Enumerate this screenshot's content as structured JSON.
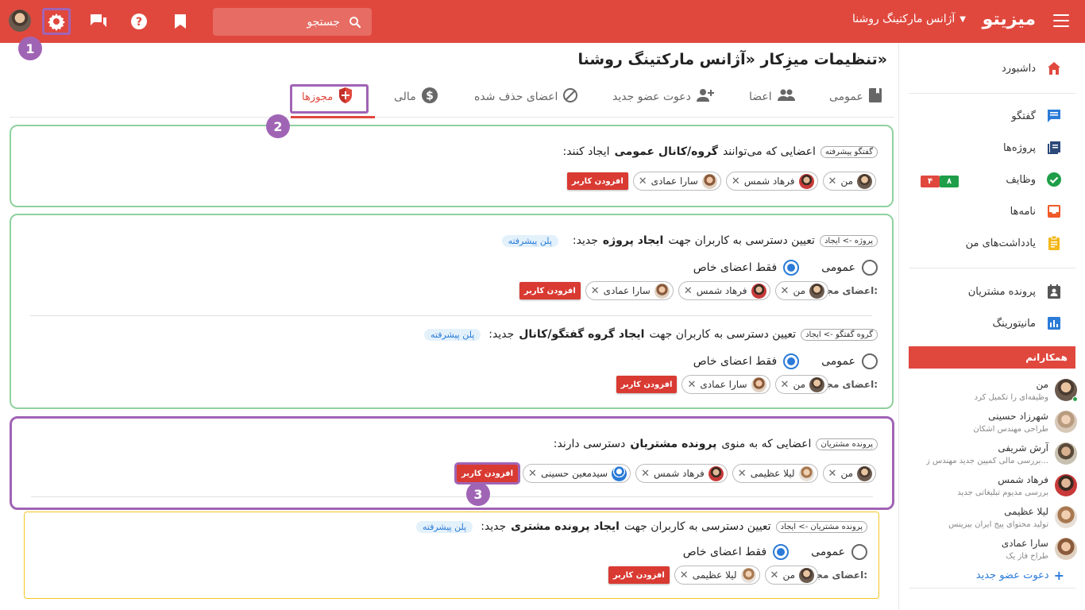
{
  "topbar": {
    "brand": "میزیتو",
    "agency": "آژانس مارکتینگ روشنا",
    "search_placeholder": "جستجو",
    "markers": [
      "1",
      "2",
      "3"
    ]
  },
  "sidebar": {
    "items": [
      {
        "label": "داشبورد",
        "icon": "home-icon",
        "color": "#e0483e"
      },
      {
        "label": "گفتگو",
        "icon": "chat-icon",
        "color": "#2b7bd8"
      },
      {
        "label": "پروژه‌ها",
        "icon": "projects-icon",
        "color": "#2c4a7a"
      },
      {
        "label": "وظایف",
        "icon": "check-circle-icon",
        "color": "#1e9e48"
      },
      {
        "label": "نامه‌ها",
        "icon": "inbox-icon",
        "color": "#f05a28"
      },
      {
        "label": "یادداشت‌های من",
        "icon": "clipboard-icon",
        "color": "#f3b71a"
      },
      {
        "label": "پرونده مشتریان",
        "icon": "contact-book-icon",
        "color": "#555555"
      },
      {
        "label": "مانیتورینگ",
        "icon": "chart-icon",
        "color": "#2b7bd8"
      }
    ],
    "task_badges": [
      "۸",
      "۴"
    ],
    "colleagues_title": "همکارانم",
    "colleagues": [
      {
        "name": "من",
        "subtitle": "وظیفه‌ای را تکمیل کرد"
      },
      {
        "name": "شهرزاد حسینی",
        "subtitle": "طراحی مهندس اشکان"
      },
      {
        "name": "آرش شریفی",
        "subtitle": "بررسی مالی کمپین جدید مهندس ز..."
      },
      {
        "name": "فرهاد شمس",
        "subtitle": "بررسی مدیوم تبلیغاتی جدید"
      },
      {
        "name": "لیلا عظیمی",
        "subtitle": "تولید محتوای پیج ایران بیزینس"
      },
      {
        "name": "سارا عمادی",
        "subtitle": "طراح فاز یک"
      }
    ],
    "invite_label": "دعوت عضو جدید"
  },
  "main": {
    "title": "تنظیمات میزِکار «آژانس مارکتینگ روشنا»",
    "tabs": [
      {
        "label": "عمومی",
        "icon": "book-icon"
      },
      {
        "label": "اعضا",
        "icon": "group-icon"
      },
      {
        "label": "دعوت عضو جدید",
        "icon": "person-add-icon"
      },
      {
        "label": "اعضای حذف شده",
        "icon": "block-icon"
      },
      {
        "label": "مالی",
        "icon": "dollar-icon"
      },
      {
        "label": "مجوزها",
        "icon": "shield-icon"
      }
    ],
    "add_user": "افزودن کاربر",
    "plan_badge": "پلن پیشرفته",
    "allowed_members": "اعضای مجاز:",
    "radio_public": "عمومی",
    "radio_private": "فقط اعضای خاص",
    "section1": {
      "tag": "گفتگو پیشرفته",
      "text_before": "اعضایی که می‌توانند",
      "text_bold": "گروه/کانال عمومی",
      "text_after": "ایجاد کنند:",
      "chips": [
        "من",
        "فرهاد شمس",
        "سارا عمادی"
      ]
    },
    "section2a": {
      "tag": "پروژه -> ایجاد",
      "text_before": "تعیین دسترسی به کاربران جهت",
      "text_bold": "ایجاد پروژه",
      "text_after": "جدید:",
      "chips": [
        "من",
        "فرهاد شمس",
        "سارا عمادی"
      ]
    },
    "section2b": {
      "tag": "گروه گفتگو -> ایجاد",
      "text_before": "تعیین دسترسی به کاربران جهت",
      "text_bold": "ایجاد گروه گفتگو/کانال",
      "text_after": "جدید:",
      "chips": [
        "من",
        "سارا عمادی"
      ]
    },
    "section3": {
      "tag": "پرونده مشتریان",
      "text_before": "اعضایی که به منوی",
      "text_bold": "پرونده مشتریان",
      "text_after": "دسترسی دارند:",
      "chips": [
        "من",
        "لیلا عظیمی",
        "فرهاد شمس",
        "سیدمعین حسینی"
      ]
    },
    "section4": {
      "tag": "پرونده مشتریان -> ایجاد",
      "text_before": "تعیین دسترسی به کاربران جهت",
      "text_bold": "ایجاد پرونده مشتری",
      "text_after": "جدید:",
      "chips": [
        "من",
        "لیلا عظیمی"
      ]
    }
  },
  "colors": {
    "primary": "#e0483e",
    "marker": "#a064b5",
    "accent": "#2b7bd8",
    "green_border": "#8fd19e",
    "yellow_border": "#f3c623"
  }
}
